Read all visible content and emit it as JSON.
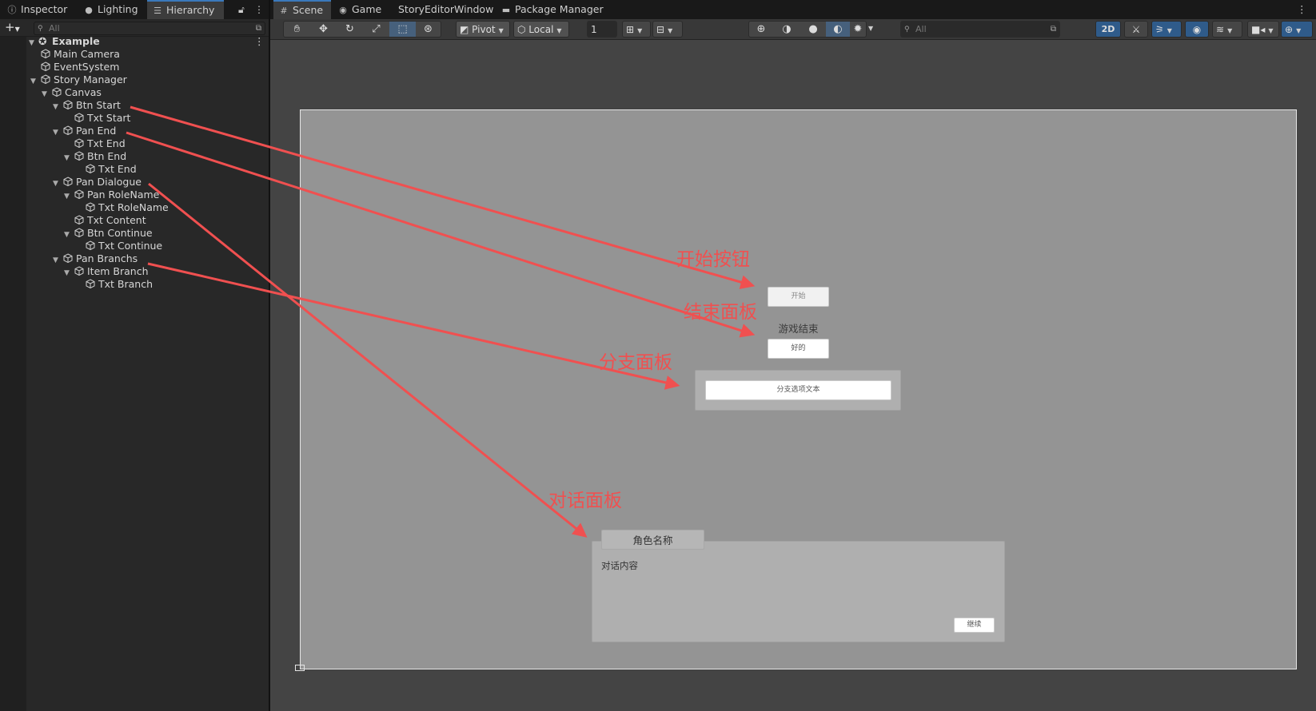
{
  "left_tabs": [
    {
      "label": "Inspector",
      "icon": "info-icon"
    },
    {
      "label": "Lighting",
      "icon": "bulb-icon"
    },
    {
      "label": "Hierarchy",
      "icon": "list-icon",
      "active": true
    }
  ],
  "hierarchy": {
    "search_placeholder": "All",
    "root": "Example",
    "items": [
      {
        "label": "Main Camera",
        "depth": 1
      },
      {
        "label": "EventSystem",
        "depth": 1
      },
      {
        "label": "Story Manager",
        "depth": 1,
        "expanded": true
      },
      {
        "label": "Canvas",
        "depth": 2,
        "expanded": true
      },
      {
        "label": "Btn Start",
        "depth": 3,
        "expanded": true
      },
      {
        "label": "Txt Start",
        "depth": 4
      },
      {
        "label": "Pan End",
        "depth": 3,
        "expanded": true
      },
      {
        "label": "Txt End",
        "depth": 4
      },
      {
        "label": "Btn End",
        "depth": 4,
        "expanded": true
      },
      {
        "label": "Txt End",
        "depth": 5
      },
      {
        "label": "Pan Dialogue",
        "depth": 3,
        "expanded": true
      },
      {
        "label": "Pan RoleName",
        "depth": 4,
        "expanded": true
      },
      {
        "label": "Txt RoleName",
        "depth": 5
      },
      {
        "label": "Txt Content",
        "depth": 4
      },
      {
        "label": "Btn Continue",
        "depth": 4,
        "expanded": true
      },
      {
        "label": "Txt Continue",
        "depth": 5
      },
      {
        "label": "Pan Branchs",
        "depth": 3,
        "expanded": true
      },
      {
        "label": "Item Branch",
        "depth": 4,
        "expanded": true
      },
      {
        "label": "Txt Branch",
        "depth": 5
      }
    ]
  },
  "scene_tabs": [
    {
      "label": "Scene",
      "icon": "grid-icon",
      "active": true
    },
    {
      "label": "Game",
      "icon": "gamepad-icon"
    },
    {
      "label": "StoryEditorWindow"
    },
    {
      "label": "Package Manager",
      "icon": "package-icon"
    }
  ],
  "scene_toolbar": {
    "pivot": "Pivot",
    "local": "Local",
    "grid_value": "1",
    "search_placeholder": "All",
    "mode_2d": "2D"
  },
  "canvas": {
    "start_button": "开始",
    "end_text": "游戏结束",
    "end_button": "好的",
    "branch_item": "分支选项文本",
    "role_name": "角色名称",
    "dialogue_content": "对话内容",
    "continue_button": "继续"
  },
  "annotations": {
    "start": "开始按钮",
    "end": "结束面板",
    "branch": "分支面板",
    "dialogue": "对话面板"
  },
  "colors": {
    "annotation": "#f05050",
    "accent": "#3a79bb"
  }
}
